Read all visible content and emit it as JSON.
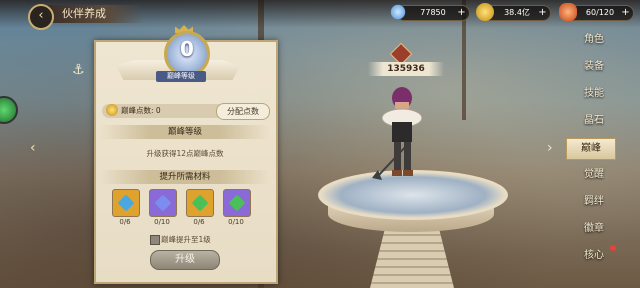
{
  "header": {
    "title": "伙伴养成",
    "back_icon": "back-arrow-icon"
  },
  "resources": [
    {
      "name": "diamond",
      "value": "77850",
      "icon": "diamond-icon",
      "color": "#6fb5ff"
    },
    {
      "name": "gold",
      "value": "38.4亿",
      "icon": "gold-coin-icon",
      "color": "#e9b53b"
    },
    {
      "name": "stamina",
      "value": "60/120",
      "icon": "meat-icon",
      "color": "#e96b2a"
    }
  ],
  "panel": {
    "peak_level_value": "0",
    "peak_level_label": "巅峰等级",
    "points_label": "巅峰点数: 0",
    "allocate_button": "分配点数",
    "level_section_title": "巅峰等级",
    "level_desc": "升级获得12点巅峰点数",
    "materials_title": "提升所需材料",
    "materials": [
      {
        "count": "0/6",
        "bg": "#e0a22e",
        "gem": "#4aa8e0"
      },
      {
        "count": "0/10",
        "bg": "#8a6ad6",
        "gem": "#7c8cf0"
      },
      {
        "count": "0/6",
        "bg": "#e0a22e",
        "gem": "#4bbf58"
      },
      {
        "count": "0/10",
        "bg": "#8a6ad6",
        "gem": "#4bbf58"
      }
    ],
    "checkbox_label": "巅峰提升至1级",
    "upgrade_button": "升级"
  },
  "character": {
    "power": "135936"
  },
  "menu": {
    "items": [
      "角色",
      "装备",
      "技能",
      "晶石",
      "巅峰",
      "觉醒",
      "羁绊",
      "徽章",
      "核心"
    ],
    "active_index": 4
  }
}
